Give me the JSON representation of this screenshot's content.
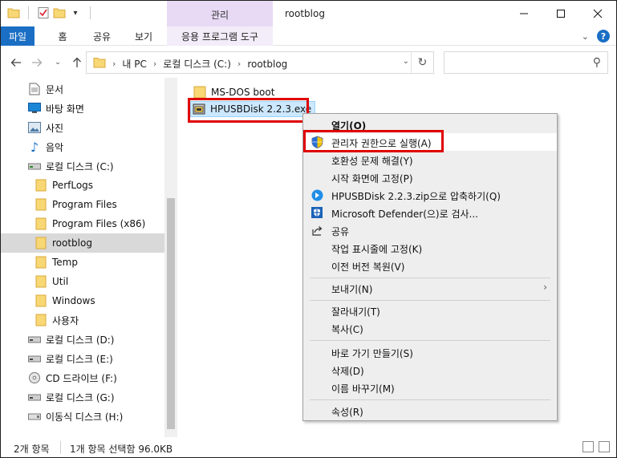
{
  "window": {
    "title": "rootblog",
    "manage_label": "관리"
  },
  "ribbon": {
    "tabs": [
      {
        "label": "파일"
      },
      {
        "label": "홈"
      },
      {
        "label": "공유"
      },
      {
        "label": "보기"
      },
      {
        "label": "응용 프로그램 도구"
      }
    ]
  },
  "address": {
    "crumbs": [
      "내 PC",
      "로컬 디스크 (C:)",
      "rootblog"
    ],
    "search_placeholder": ""
  },
  "nav": {
    "items": [
      {
        "label": "문서",
        "icon": "document-icon"
      },
      {
        "label": "바탕 화면",
        "icon": "desktop-icon"
      },
      {
        "label": "사진",
        "icon": "pictures-icon"
      },
      {
        "label": "음악",
        "icon": "music-icon"
      },
      {
        "label": "로컬 디스크 (C:)",
        "icon": "drive-icon"
      },
      {
        "label": "PerfLogs",
        "icon": "folder-icon"
      },
      {
        "label": "Program Files",
        "icon": "folder-icon"
      },
      {
        "label": "Program Files (x86)",
        "icon": "folder-icon"
      },
      {
        "label": "rootblog",
        "icon": "folder-icon",
        "selected": true
      },
      {
        "label": "Temp",
        "icon": "folder-icon"
      },
      {
        "label": "Util",
        "icon": "folder-icon"
      },
      {
        "label": "Windows",
        "icon": "folder-icon"
      },
      {
        "label": "사용자",
        "icon": "folder-icon"
      },
      {
        "label": "로컬 디스크 (D:)",
        "icon": "drive-icon"
      },
      {
        "label": "로컬 디스크 (E:)",
        "icon": "drive-icon"
      },
      {
        "label": "CD 드라이브 (F:)",
        "icon": "cd-drive-icon"
      },
      {
        "label": "로컬 디스크 (G:)",
        "icon": "drive-icon"
      },
      {
        "label": "이동식 디스크 (H:)",
        "icon": "removable-drive-icon"
      }
    ]
  },
  "files": [
    {
      "name": "MS-DOS boot",
      "icon": "folder-icon"
    },
    {
      "name": "HPUSBDisk 2.2.3.exe",
      "icon": "exe-icon",
      "selected": true
    }
  ],
  "context_menu": {
    "items": [
      {
        "label": "열기(O)",
        "bold": true
      },
      {
        "label": "관리자 권한으로 실행(A)",
        "icon": "uac-shield-icon",
        "highlight": true
      },
      {
        "label": "호환성 문제 해결(Y)"
      },
      {
        "label": "시작 화면에 고정(P)"
      },
      {
        "label": "HPUSBDisk 2.2.3.zip으로 압축하기(Q)",
        "icon": "bandizip-icon"
      },
      {
        "label": "Microsoft Defender(으)로 검사...",
        "icon": "defender-icon"
      },
      {
        "label": "공유",
        "icon": "share-icon"
      },
      {
        "label": "작업 표시줄에 고정(K)"
      },
      {
        "label": "이전 버전 복원(V)"
      },
      {
        "label": "보내기(N)",
        "submenu": true
      },
      {
        "label": "잘라내기(T)"
      },
      {
        "label": "복사(C)"
      },
      {
        "label": "바로 가기 만들기(S)"
      },
      {
        "label": "삭제(D)"
      },
      {
        "label": "이름 바꾸기(M)"
      },
      {
        "label": "속성(R)"
      }
    ]
  },
  "status": {
    "item_count": "2개 항목",
    "selection": "1개 항목 선택함 96.0KB"
  },
  "colors": {
    "accent": "#1a6fc4",
    "manage_tab": "#e8daf5",
    "highlight_box": "#e00000",
    "selection": "#cce8ff"
  }
}
